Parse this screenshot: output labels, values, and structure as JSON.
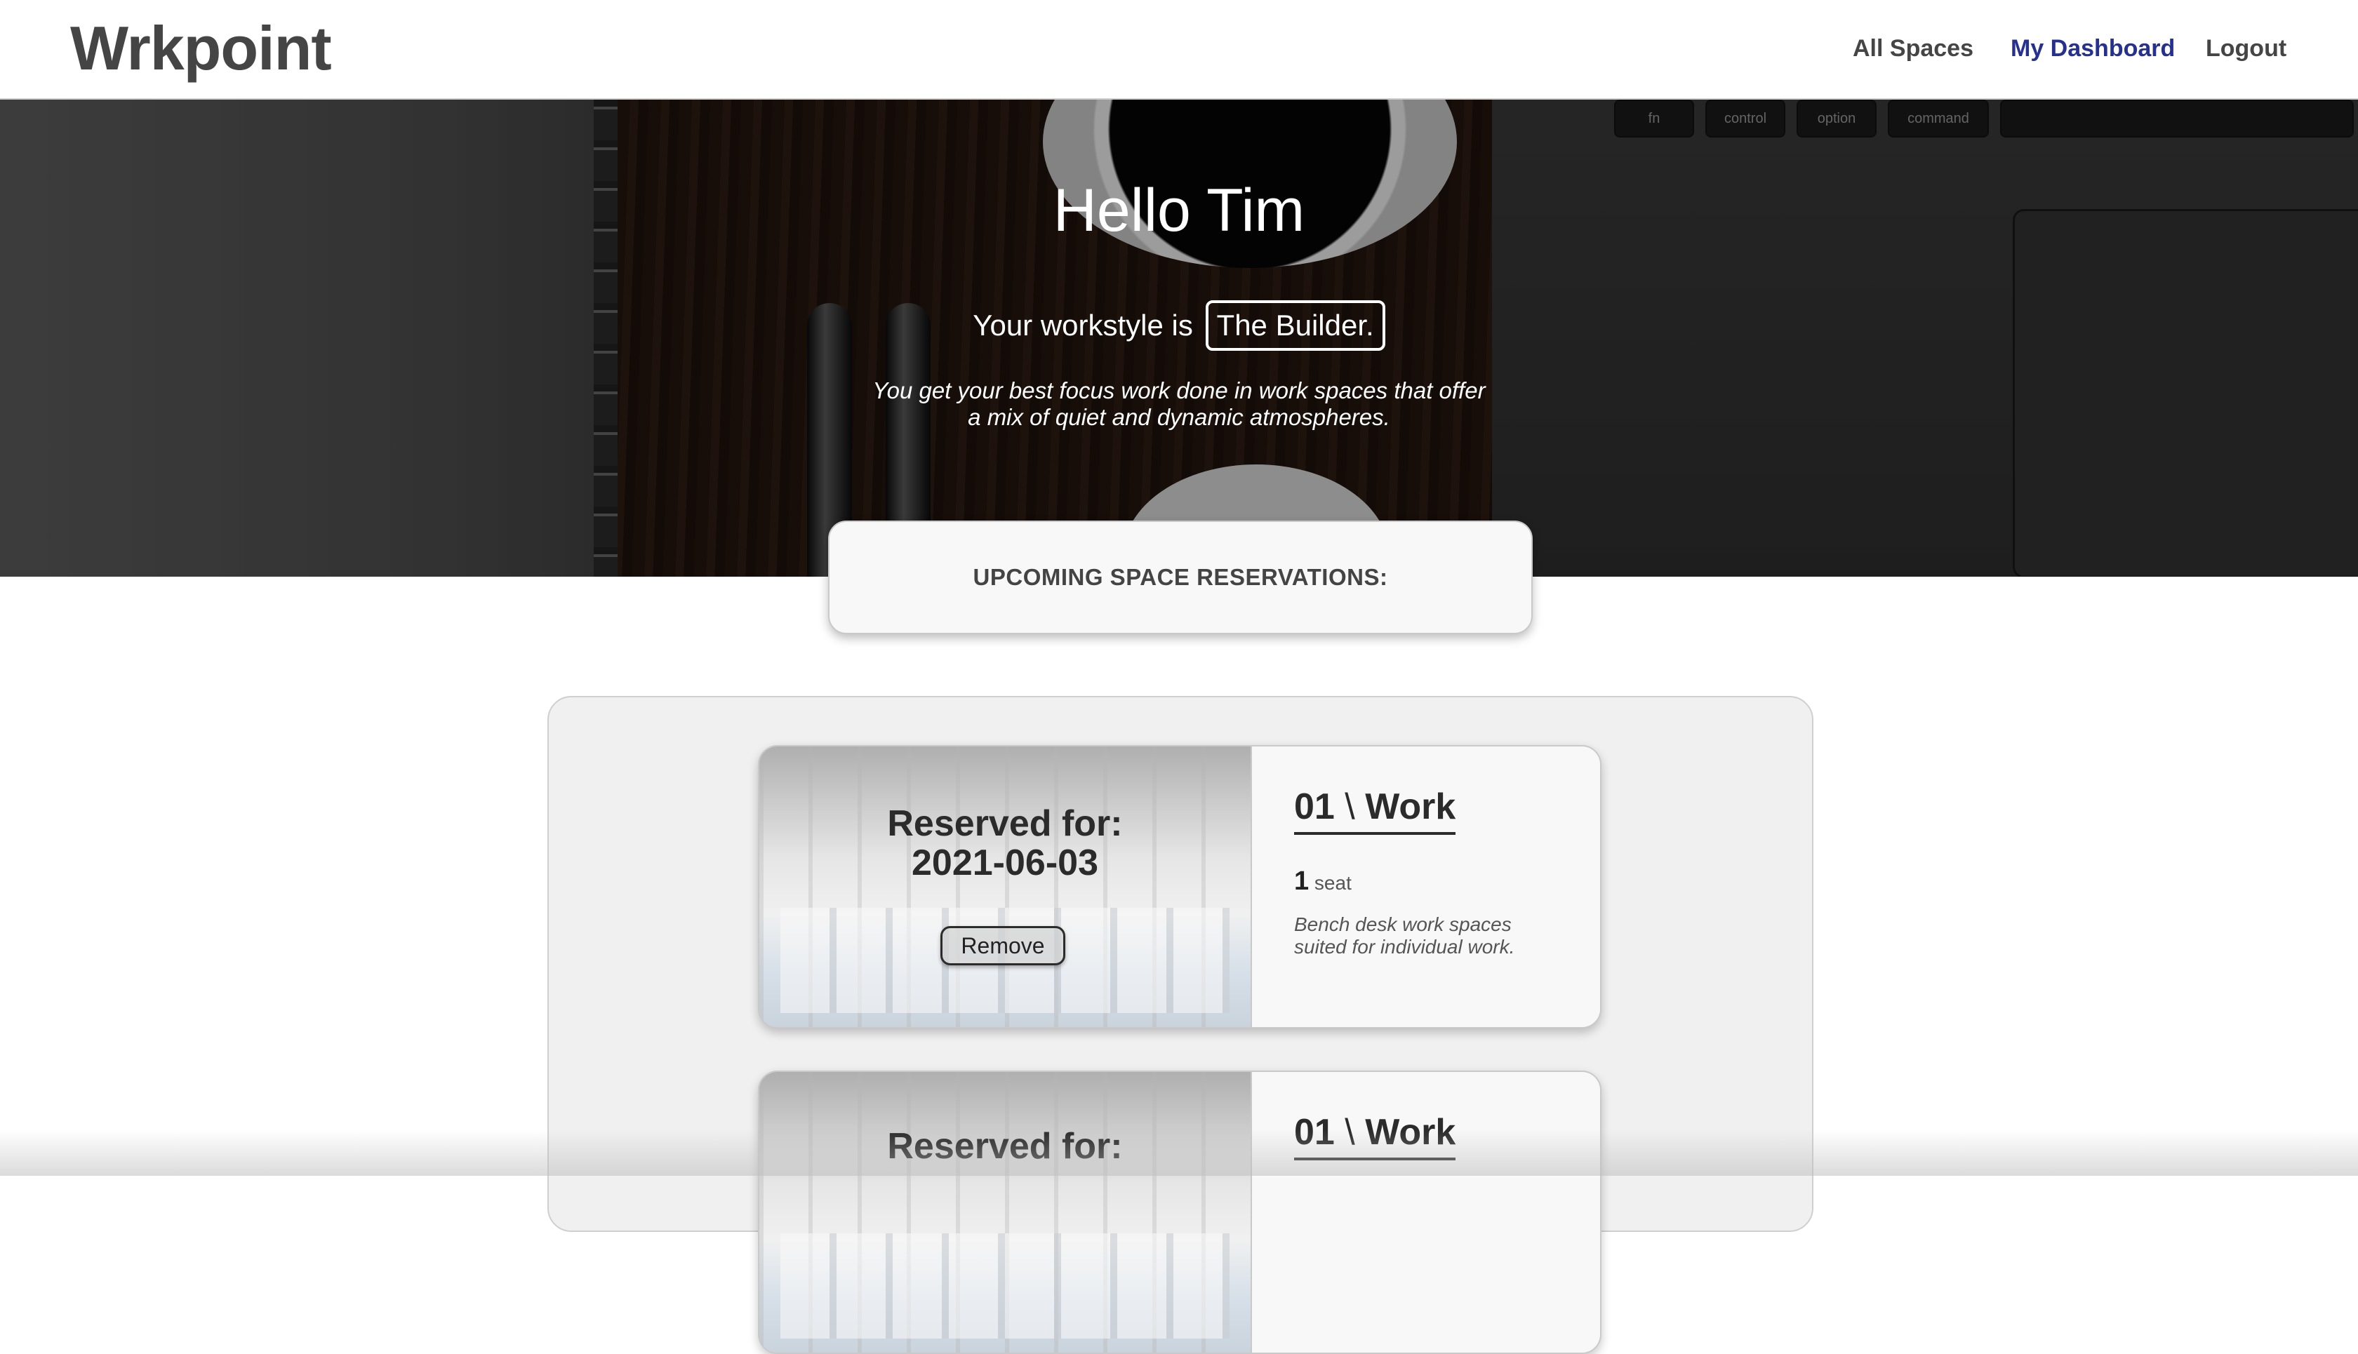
{
  "header": {
    "logo": "Wrkpoint",
    "nav": [
      {
        "label": "All Spaces",
        "active": false
      },
      {
        "label": "My Dashboard",
        "active": true
      },
      {
        "label": "Logout",
        "active": false
      }
    ]
  },
  "hero": {
    "greeting": "Hello Tim",
    "workstyle_prefix": "Your workstyle is",
    "workstyle": "The Builder.",
    "description": "You get your best focus work done in work spaces that offer a mix of quiet and dynamic atmospheres.",
    "keyboard_keys": [
      "fn",
      "control",
      "option",
      "command"
    ]
  },
  "upcoming": {
    "title": "UPCOMING SPACE RESERVATIONS:"
  },
  "reservations": [
    {
      "reserved_label": "Reserved for:",
      "date": "2021-06-03",
      "remove_label": "Remove",
      "space_number": "01",
      "space_separator": "\\",
      "space_type": "Work",
      "seats": "1",
      "seats_unit": "seat",
      "description": "Bench desk work spaces suited for individual work."
    },
    {
      "reserved_label": "Reserved for:",
      "space_number": "01",
      "space_separator": "\\",
      "space_type": "Work"
    }
  ],
  "colors": {
    "nav_active": "#26308f",
    "nav_text": "#454545",
    "panel_bg": "#f0f0f0",
    "card_bg": "#f8f8f8"
  }
}
